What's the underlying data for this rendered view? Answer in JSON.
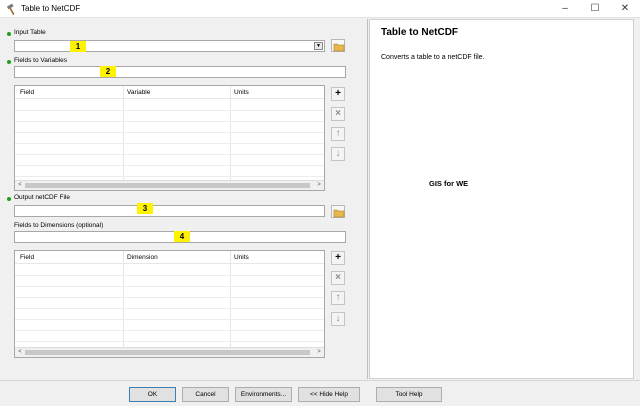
{
  "window": {
    "title": "Table to NetCDF",
    "controls": [
      "–",
      "☐",
      "✕"
    ]
  },
  "form": {
    "input_table": {
      "label": "Input Table",
      "value": "",
      "badge": "1"
    },
    "fields_to_variables": {
      "label": "Fields to Variables",
      "value": "",
      "badge": "2"
    },
    "variables_grid": {
      "columns": [
        "Field",
        "Variable",
        "Units"
      ],
      "rows": []
    },
    "output_file": {
      "label": "Output netCDF File",
      "value": "",
      "badge": "3"
    },
    "fields_to_dimensions": {
      "label": "Fields to Dimensions (optional)",
      "value": "",
      "badge": "4"
    },
    "dimensions_grid": {
      "columns": [
        "Field",
        "Dimension",
        "Units"
      ],
      "rows": []
    },
    "side_buttons": {
      "add": "+",
      "remove": "×",
      "up": "↑",
      "down": "↓"
    },
    "scroll_arrows": {
      "left": "<",
      "right": ">"
    }
  },
  "help": {
    "title": "Table to NetCDF",
    "description": "Converts a table to a netCDF file.",
    "watermark": "GIS for WE"
  },
  "buttons": {
    "ok": "OK",
    "cancel": "Cancel",
    "environments": "Environments...",
    "hide_help": "<< Hide Help",
    "tool_help": "Tool Help"
  },
  "colors": {
    "required_dot": "#1ea01e",
    "highlight": "#fff200",
    "folder": "#e8b84a"
  }
}
